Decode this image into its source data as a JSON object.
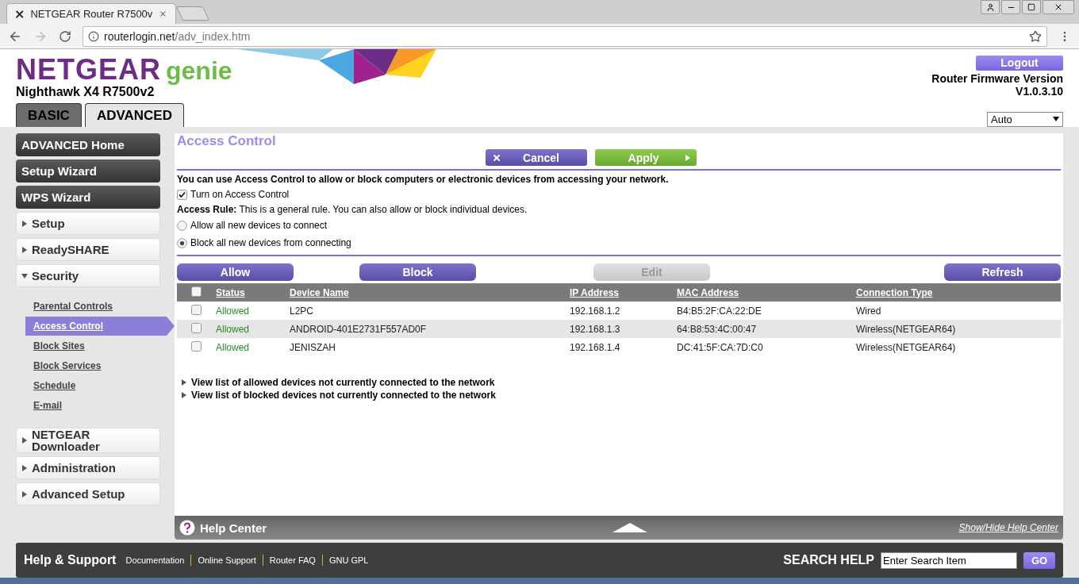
{
  "browser": {
    "tabs": [
      {
        "title": "NETGEAR Router R7500v",
        "selected": true,
        "kind": "page"
      },
      {
        "kind": "new"
      }
    ],
    "url_host": "routerlogin.net",
    "url_path": "/adv_index.htm"
  },
  "header": {
    "brand": "NETGEAR",
    "brand_suffix": "genie",
    "model": "Nighthawk X4 R7500v2",
    "logout": "Logout",
    "firmware_label": "Router Firmware Version",
    "firmware_version": "V1.0.3.10",
    "language": "Auto"
  },
  "mode_tabs": [
    {
      "label": "BASIC",
      "selected": false
    },
    {
      "label": "ADVANCED",
      "selected": true
    }
  ],
  "sidebar": {
    "items": [
      {
        "label": "ADVANCED Home",
        "kind": "dark"
      },
      {
        "label": "Setup Wizard",
        "kind": "dark"
      },
      {
        "label": "WPS Wizard",
        "kind": "dark"
      },
      {
        "label": "Setup",
        "kind": "section",
        "expanded": false
      },
      {
        "label": "ReadySHARE",
        "kind": "section",
        "expanded": false
      },
      {
        "label": "Security",
        "kind": "section",
        "expanded": true,
        "children": [
          {
            "label": "Parental Controls",
            "selected": false
          },
          {
            "label": "Access Control",
            "selected": true
          },
          {
            "label": "Block Sites",
            "selected": false
          },
          {
            "label": "Block Services",
            "selected": false
          },
          {
            "label": "Schedule",
            "selected": false
          },
          {
            "label": "E-mail",
            "selected": false
          }
        ]
      },
      {
        "label": "NETGEAR Downloader",
        "kind": "section",
        "expanded": false
      },
      {
        "label": "Administration",
        "kind": "section",
        "expanded": false
      },
      {
        "label": "Advanced Setup",
        "kind": "section",
        "expanded": false
      }
    ]
  },
  "page": {
    "title": "Access Control",
    "cancel": "Cancel",
    "apply": "Apply",
    "intro": "You can use Access Control to allow or block computers or electronic devices from accessing your network.",
    "turn_on": {
      "label": "Turn on Access Control",
      "checked": true
    },
    "rule": "**Access Rule:** This is a general rule. You can also allow or block individual devices.",
    "rule_options": [
      {
        "label": "Allow all new devices to connect",
        "selected": false
      },
      {
        "label": "Block all new devices from connecting",
        "selected": true
      }
    ],
    "actions": [
      {
        "label": "Allow",
        "disabled": false
      },
      {
        "label": "Block",
        "disabled": false
      },
      {
        "label": "Edit",
        "disabled": true
      },
      {
        "label": "Refresh",
        "disabled": false
      }
    ],
    "table": {
      "select_all_checked": false,
      "columns": [
        "Status",
        "Device Name",
        "IP Address",
        "MAC Address",
        "Connection Type"
      ],
      "rows": [
        {
          "checked": false,
          "cells": [
            "Allowed",
            "L2PC",
            "192.168.1.2",
            "B4:B5:2F:CA:22:DE",
            "Wired"
          ]
        },
        {
          "checked": false,
          "cells": [
            "Allowed",
            "ANDROID-401E2731F557AD0F",
            "192.168.1.3",
            "64:B8:53:4C:00:47",
            "Wireless(NETGEAR64)"
          ]
        },
        {
          "checked": false,
          "cells": [
            "Allowed",
            "JENISZAH",
            "192.168.1.4",
            "DC:41:5F:CA:7D:C0",
            "Wireless(NETGEAR64)"
          ]
        }
      ]
    },
    "lists": [
      {
        "label": "View list of allowed devices not currently connected to the network",
        "expanded": false
      },
      {
        "label": "View list of blocked devices not currently connected to the network",
        "expanded": false
      }
    ]
  },
  "help_center": {
    "title": "Help Center",
    "toggle": "Show/Hide Help Center"
  },
  "footer": {
    "title": "Help & Support",
    "links": [
      "Documentation",
      "Online Support",
      "Router FAQ",
      "GNU GPL"
    ],
    "search_label": "SEARCH HELP",
    "search_value": "Enter Search Item",
    "go": "GO"
  }
}
